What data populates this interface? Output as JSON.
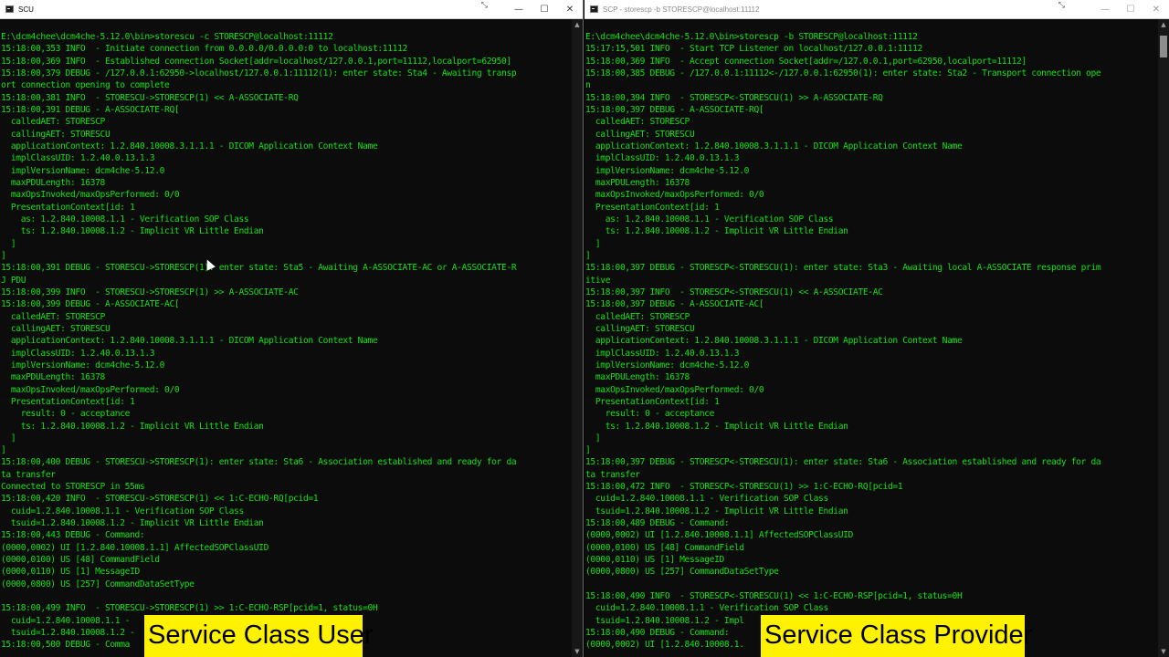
{
  "left_window": {
    "title": "SCU",
    "extra_icon": "⤡",
    "controls": {
      "minimize": "—",
      "maximize": "☐",
      "close": "✕"
    },
    "lines": [
      "E:\\dcm4chee\\dcm4che-5.12.0\\bin>storescu -c STORESCP@localhost:11112",
      "15:18:00,353 INFO  - Initiate connection from 0.0.0.0/0.0.0.0:0 to localhost:11112",
      "15:18:00,369 INFO  - Established connection Socket[addr=localhost/127.0.0.1,port=11112,localport=62950]",
      "15:18:00,379 DEBUG - /127.0.0.1:62950->localhost/127.0.0.1:11112(1): enter state: Sta4 - Awaiting transp",
      "ort connection opening to complete",
      "15:18:00,381 INFO  - STORESCU->STORESCP(1) << A-ASSOCIATE-RQ",
      "15:18:00,391 DEBUG - A-ASSOCIATE-RQ[",
      "  calledAET: STORESCP",
      "  callingAET: STORESCU",
      "  applicationContext: 1.2.840.10008.3.1.1.1 - DICOM Application Context Name",
      "  implClassUID: 1.2.40.0.13.1.3",
      "  implVersionName: dcm4che-5.12.0",
      "  maxPDULength: 16378",
      "  maxOpsInvoked/maxOpsPerformed: 0/0",
      "  PresentationContext[id: 1",
      "    as: 1.2.840.10008.1.1 - Verification SOP Class",
      "    ts: 1.2.840.10008.1.2 - Implicit VR Little Endian",
      "  ]",
      "]",
      "15:18:00,391 DEBUG - STORESCU->STORESCP(1): enter state: Sta5 - Awaiting A-ASSOCIATE-AC or A-ASSOCIATE-R",
      "J PDU",
      "15:18:00,399 INFO  - STORESCU->STORESCP(1) >> A-ASSOCIATE-AC",
      "15:18:00,399 DEBUG - A-ASSOCIATE-AC[",
      "  calledAET: STORESCP",
      "  callingAET: STORESCU",
      "  applicationContext: 1.2.840.10008.3.1.1.1 - DICOM Application Context Name",
      "  implClassUID: 1.2.40.0.13.1.3",
      "  implVersionName: dcm4che-5.12.0",
      "  maxPDULength: 16378",
      "  maxOpsInvoked/maxOpsPerformed: 0/0",
      "  PresentationContext[id: 1",
      "    result: 0 - acceptance",
      "    ts: 1.2.840.10008.1.2 - Implicit VR Little Endian",
      "  ]",
      "]",
      "15:18:00,400 DEBUG - STORESCU->STORESCP(1): enter state: Sta6 - Association established and ready for da",
      "ta transfer",
      "Connected to STORESCP in 55ms",
      "15:18:00,420 INFO  - STORESCU->STORESCP(1) << 1:C-ECHO-RQ[pcid=1",
      "  cuid=1.2.840.10008.1.1 - Verification SOP Class",
      "  tsuid=1.2.840.10008.1.2 - Implicit VR Little Endian",
      "15:18:00,443 DEBUG - Command:",
      "(0000,0002) UI [1.2.840.10008.1.1] AffectedSOPClassUID",
      "(0000,0100) US [48] CommandField",
      "(0000,0110) US [1] MessageID",
      "(0000,0800) US [257] CommandDataSetType",
      "",
      "15:18:00,499 INFO  - STORESCU->STORESCP(1) >> 1:C-ECHO-RSP[pcid=1, status=0H",
      "  cuid=1.2.840.10008.1.1 -",
      "  tsuid=1.2.840.10008.1.2 -",
      "15:18:00,500 DEBUG - Comma"
    ]
  },
  "right_window": {
    "title": "SCP - storescp  -b STORESCP@localhost:11112",
    "extra_icon": "⤡",
    "controls": {
      "minimize": "—",
      "maximize": "☐",
      "close": "✕"
    },
    "lines": [
      "E:\\dcm4chee\\dcm4che-5.12.0\\bin>storescp -b STORESCP@localhost:11112",
      "15:17:15,501 INFO  - Start TCP Listener on localhost/127.0.0.1:11112",
      "15:18:00,369 INFO  - Accept connection Socket[addr=/127.0.0.1,port=62950,localport=11112]",
      "15:18:00,385 DEBUG - /127.0.0.1:11112<-/127.0.0.1:62950(1): enter state: Sta2 - Transport connection ope",
      "n",
      "15:18:00,394 INFO  - STORESCP<-STORESCU(1) >> A-ASSOCIATE-RQ",
      "15:18:00,397 DEBUG - A-ASSOCIATE-RQ[",
      "  calledAET: STORESCP",
      "  callingAET: STORESCU",
      "  applicationContext: 1.2.840.10008.3.1.1.1 - DICOM Application Context Name",
      "  implClassUID: 1.2.40.0.13.1.3",
      "  implVersionName: dcm4che-5.12.0",
      "  maxPDULength: 16378",
      "  maxOpsInvoked/maxOpsPerformed: 0/0",
      "  PresentationContext[id: 1",
      "    as: 1.2.840.10008.1.1 - Verification SOP Class",
      "    ts: 1.2.840.10008.1.2 - Implicit VR Little Endian",
      "  ]",
      "]",
      "15:18:00,397 DEBUG - STORESCP<-STORESCU(1): enter state: Sta3 - Awaiting local A-ASSOCIATE response prim",
      "itive",
      "15:18:00,397 INFO  - STORESCP<-STORESCU(1) << A-ASSOCIATE-AC",
      "15:18:00,397 DEBUG - A-ASSOCIATE-AC[",
      "  calledAET: STORESCP",
      "  callingAET: STORESCU",
      "  applicationContext: 1.2.840.10008.3.1.1.1 - DICOM Application Context Name",
      "  implClassUID: 1.2.40.0.13.1.3",
      "  implVersionName: dcm4che-5.12.0",
      "  maxPDULength: 16378",
      "  maxOpsInvoked/maxOpsPerformed: 0/0",
      "  PresentationContext[id: 1",
      "    result: 0 - acceptance",
      "    ts: 1.2.840.10008.1.2 - Implicit VR Little Endian",
      "  ]",
      "]",
      "15:18:00,397 DEBUG - STORESCP<-STORESCU(1): enter state: Sta6 - Association established and ready for da",
      "ta transfer",
      "15:18:00,472 INFO  - STORESCP<-STORESCU(1) >> 1:C-ECHO-RQ[pcid=1",
      "  cuid=1.2.840.10008.1.1 - Verification SOP Class",
      "  tsuid=1.2.840.10008.1.2 - Implicit VR Little Endian",
      "15:18:00,489 DEBUG - Command:",
      "(0000,0002) UI [1.2.840.10008.1.1] AffectedSOPClassUID",
      "(0000,0100) US [48] CommandField",
      "(0000,0110) US [1] MessageID",
      "(0000,0800) US [257] CommandDataSetType",
      "",
      "15:18:00,490 INFO  - STORESCP<-STORESCU(1) << 1:C-ECHO-RSP[pcid=1, status=0H",
      "  cuid=1.2.840.10008.1.1 - Verification SOP Class",
      "  tsuid=1.2.840.10008.1.2 - Impl",
      "15:18:00,490 DEBUG - Command:",
      "(0000,0002) UI [1.2.840.10008.1."
    ]
  },
  "labels": {
    "left": "Service Class User",
    "right": "Service Class Provider"
  },
  "colors": {
    "console_text": "#14e014",
    "console_bg": "#0c0c0c",
    "label_bg": "#fff200"
  }
}
